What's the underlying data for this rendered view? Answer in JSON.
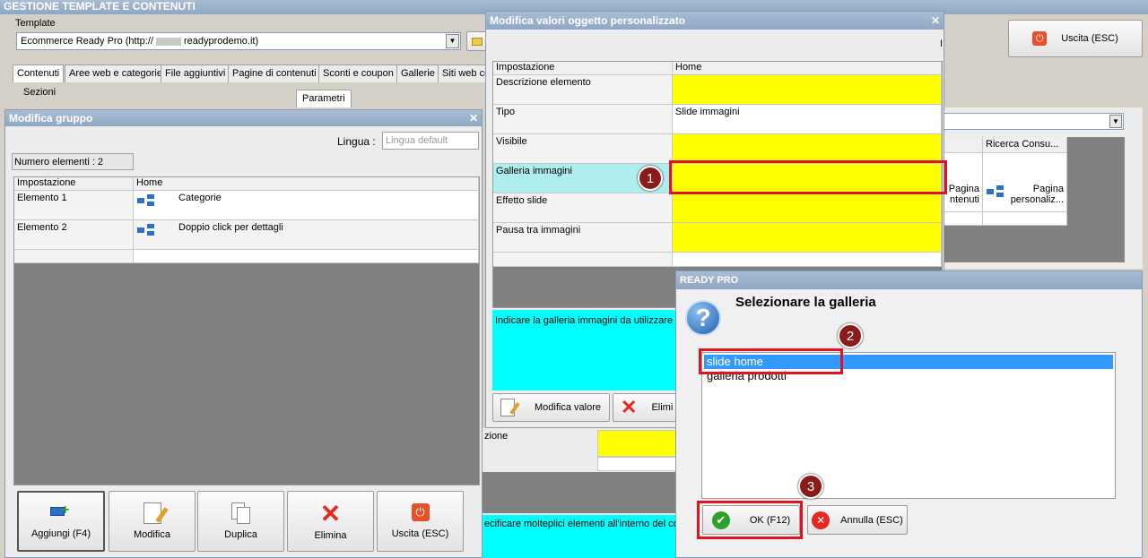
{
  "main_window": {
    "title": "GESTIONE TEMPLATE E CONTENUTI",
    "template_label": "Template",
    "template_value": "Ecommerce Ready Pro (http://",
    "template_value_suffix": "readyprodemo.it)",
    "exit_button": "Uscita (ESC)",
    "tabs": [
      "Contenuti",
      "Aree web e categorie",
      "File aggiuntivi",
      "Pagine di contenuti",
      "Sconti e coupon",
      "Gallerie",
      "Siti web co"
    ],
    "sections_label": "Sezioni",
    "params_tab": "Parametri",
    "right_grid_header": "Ricerca Consu...",
    "right_cell_a_line1": "Pagina",
    "right_cell_a_line2": "ntenuti",
    "right_cell_b_line1": "Pagina",
    "right_cell_b_line2": "personaliz..."
  },
  "group_window": {
    "title": "Modifica gruppo",
    "language_label": "Lingua :",
    "language_placeholder": "Lingua default",
    "count_label": "Numero elementi : 2",
    "col_setting": "Impostazione",
    "col_home": "Home",
    "rows": [
      {
        "name": "Elemento 1",
        "value": "Categorie"
      },
      {
        "name": "Elemento 2",
        "value": "Doppio click per dettagli"
      }
    ],
    "buttons": [
      "Aggiungi (F4)",
      "Modifica",
      "Duplica",
      "Elimina",
      "Uscita (ESC)"
    ],
    "bottom_hint": "ecificare molteplici elementi all'interno del corpo"
  },
  "object_window": {
    "title": "Modifica valori oggetto personalizzato",
    "col_setting": "Impostazione",
    "col_home": "Home",
    "rows": [
      {
        "name": "Descrizione elemento",
        "value": ""
      },
      {
        "name": "Tipo",
        "value": "Slide immagini"
      },
      {
        "name": "Visibile",
        "value": ""
      },
      {
        "name": "Galleria immagini",
        "value": ""
      },
      {
        "name": "Effetto slide",
        "value": ""
      },
      {
        "name": "Pausa tra immagini",
        "value": ""
      }
    ],
    "hint": "Indicare la galleria immagini da utilizzare pe",
    "edit_button": "Modifica valore",
    "delete_button": "Elimi",
    "under_label": "zione",
    "indicator": "I"
  },
  "dialog": {
    "title": "READY PRO",
    "question": "Selezionare la galleria",
    "options": [
      "slide home",
      "galleria prodotti"
    ],
    "ok_button": "OK (F12)",
    "cancel_button": "Annulla (ESC)"
  },
  "markers": [
    "1",
    "2",
    "3"
  ]
}
